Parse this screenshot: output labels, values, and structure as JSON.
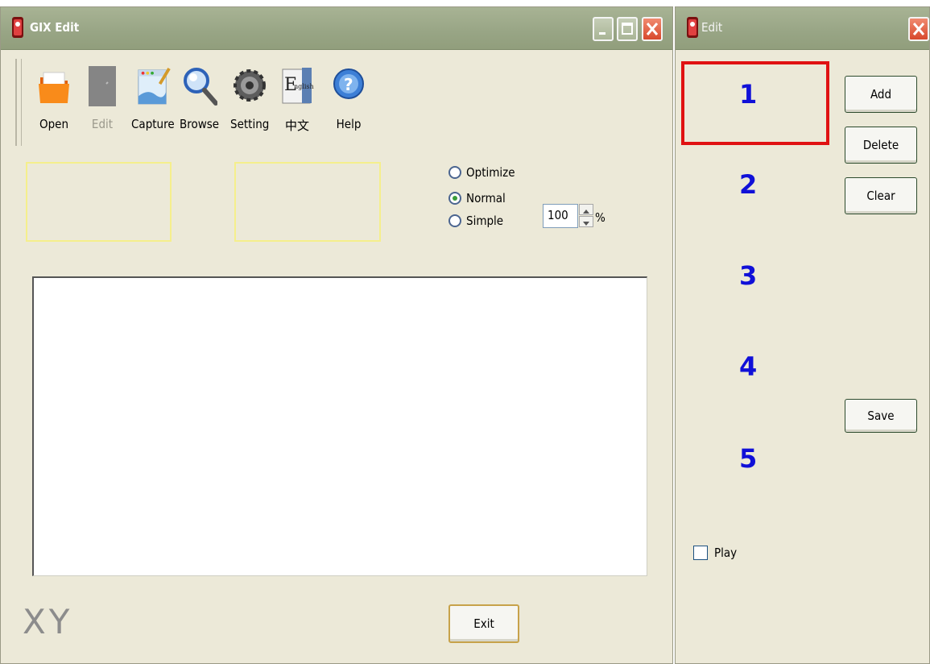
{
  "main_window": {
    "title": "GIX Edit",
    "toolbar": [
      {
        "key": "open",
        "label": "Open",
        "icon": "folder-icon",
        "enabled": true
      },
      {
        "key": "edit",
        "label": "Edit",
        "icon": "edit-icon",
        "enabled": false
      },
      {
        "key": "capture",
        "label": "Capture",
        "icon": "capture-icon",
        "enabled": true
      },
      {
        "key": "browse",
        "label": "Browse",
        "icon": "magnifier-icon",
        "enabled": true
      },
      {
        "key": "setting",
        "label": "Setting",
        "icon": "gear-icon",
        "enabled": true
      },
      {
        "key": "language",
        "label": "中文",
        "icon": "english-book-icon",
        "enabled": true
      },
      {
        "key": "help",
        "label": "Help",
        "icon": "help-icon",
        "enabled": true
      }
    ],
    "options": {
      "radios": [
        {
          "label": "Optimize",
          "checked": false
        },
        {
          "label": "Normal",
          "checked": true
        },
        {
          "label": "Simple",
          "checked": false
        }
      ],
      "scale_value": "100",
      "scale_unit": "%"
    },
    "coords_label": "XY",
    "exit_label": "Exit"
  },
  "edit_window": {
    "title": "Edit",
    "slots": [
      "1",
      "2",
      "3",
      "4",
      "5"
    ],
    "selected_slot": "1",
    "buttons": {
      "add": "Add",
      "delete": "Delete",
      "clear": "Clear",
      "save": "Save"
    },
    "play_label": "Play",
    "play_checked": false
  },
  "colors": {
    "window_bg": "#ece9d8",
    "titlebar": "#9ca888",
    "slot_number": "#1010d8",
    "selection_border": "#e01212",
    "preview_border": "#f5ef8c"
  }
}
